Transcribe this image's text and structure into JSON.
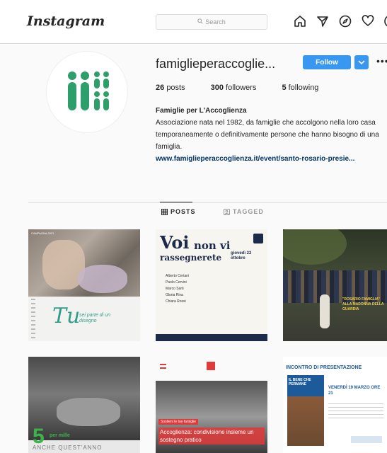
{
  "topbar": {
    "logo_text": "Instagram",
    "search_placeholder": "Search"
  },
  "profile": {
    "username": "famiglieperaccoglie...",
    "follow_label": "Follow",
    "stats": [
      {
        "value": "26",
        "label": "posts"
      },
      {
        "value": "300",
        "label": "followers"
      },
      {
        "value": "5",
        "label": "following"
      }
    ],
    "bio_name": "Famiglie per L'Accoglienza",
    "bio_text": "Associazione nata nel 1982, da famiglie che accolgono nella loro casa temporaneamente o definitivamente persone che hanno bisogno di una famiglia.",
    "bio_link": "www.famiglieperaccoglienza.it/event/santo-rosario-presie..."
  },
  "tabs": {
    "posts": "POSTS",
    "tagged": "TAGGED"
  },
  "posts": [
    {
      "top_label": "CAMPAGNA 2021",
      "title": "Tu",
      "subtitle": "sei parte di un disegno"
    },
    {
      "title_1": "Voi",
      "title_2": "non vi",
      "title_3": "rassegnerete",
      "date": "giovedì 22 ottobre",
      "names": [
        "Alberto Ceriani",
        "Paolo Cervini",
        "Marco Sarti",
        "Gloria Riva",
        "Chiara Rossi"
      ]
    },
    {
      "caption": "\"ROSARIO FAMIGLIA\" ALLA MADONNA DELLA GUARDIA"
    },
    {
      "number": "5",
      "label": "per mille",
      "bottom": "ANCHE QUEST'ANNO"
    },
    {
      "banner": "Accoglienza: condivisione insieme un sostegno pratico",
      "tag": "Sostieni le tue famiglie"
    },
    {
      "heading": "INCONTRO DI PRESENTAZIONE",
      "book_title": "IL BENE CHE PERMANE",
      "date": "VENERDÌ 19 MARZO ORE 21"
    }
  ],
  "colors": {
    "follow_blue": "#3897f0",
    "logo_green": "#2e9e6a",
    "link_color": "#003569"
  }
}
